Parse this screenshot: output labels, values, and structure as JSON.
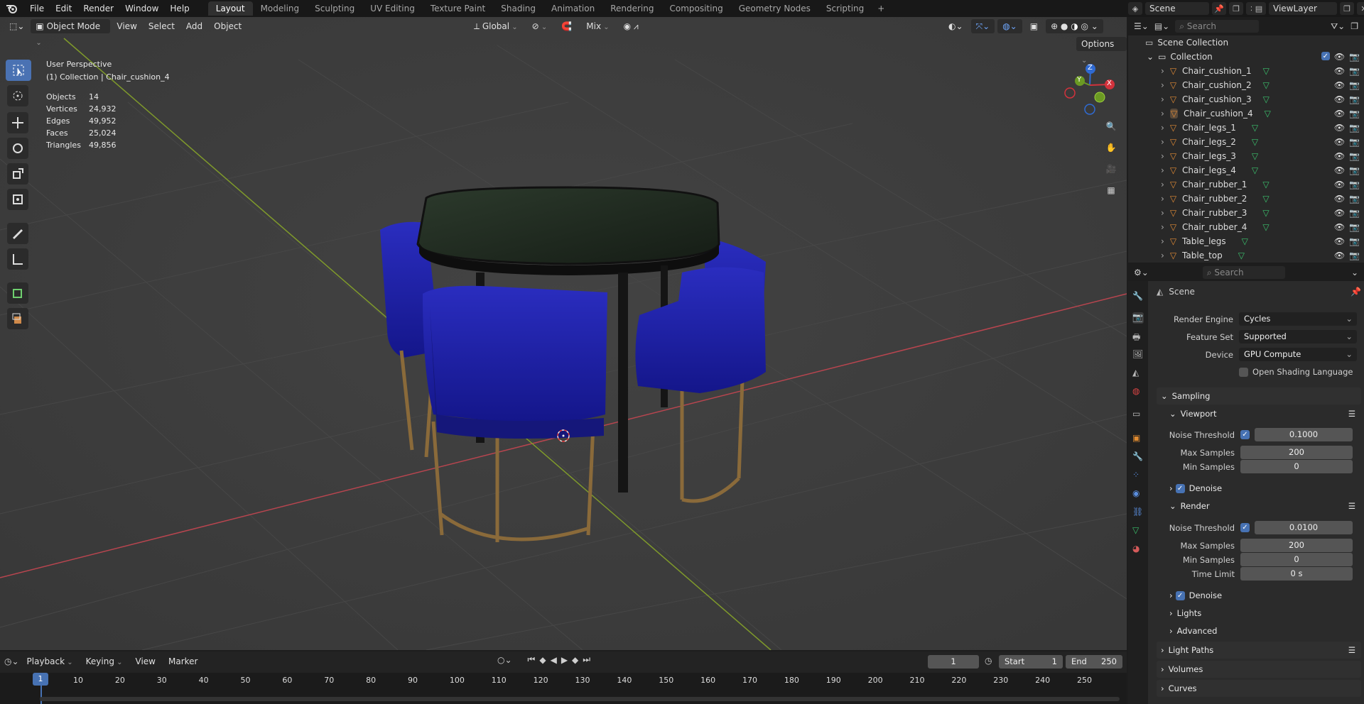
{
  "topbar": {
    "menus": [
      "File",
      "Edit",
      "Render",
      "Window",
      "Help"
    ],
    "workspaces": [
      "Layout",
      "Modeling",
      "Sculpting",
      "UV Editing",
      "Texture Paint",
      "Shading",
      "Animation",
      "Rendering",
      "Compositing",
      "Geometry Nodes",
      "Scripting"
    ],
    "active_workspace": "Layout",
    "add_tab": "+",
    "scene": "Scene",
    "view_layer": "ViewLayer"
  },
  "viewport": {
    "mode": "Object Mode",
    "menus": [
      "View",
      "Select",
      "Add",
      "Object"
    ],
    "orientation": "Global",
    "snap_mode": "Mix",
    "options": "Options",
    "perspective": "User Perspective",
    "context": "(1) Collection | Chair_cushion_4",
    "stats": [
      {
        "label": "Objects",
        "value": "14"
      },
      {
        "label": "Vertices",
        "value": "24,932"
      },
      {
        "label": "Edges",
        "value": "49,952"
      },
      {
        "label": "Faces",
        "value": "25,024"
      },
      {
        "label": "Triangles",
        "value": "49,856"
      }
    ],
    "gizmo": {
      "x": "X",
      "y": "Y",
      "z": "Z"
    }
  },
  "outliner": {
    "search_placeholder": "Search",
    "root": "Scene Collection",
    "collection": "Collection",
    "items": [
      "Chair_cushion_1",
      "Chair_cushion_2",
      "Chair_cushion_3",
      "Chair_cushion_4",
      "Chair_legs_1",
      "Chair_legs_2",
      "Chair_legs_3",
      "Chair_legs_4",
      "Chair_rubber_1",
      "Chair_rubber_2",
      "Chair_rubber_3",
      "Chair_rubber_4",
      "Table_legs",
      "Table_top"
    ],
    "selected": "Chair_cushion_4"
  },
  "properties": {
    "search_placeholder": "Search",
    "context_title": "Scene",
    "render_engine_label": "Render Engine",
    "render_engine": "Cycles",
    "feature_set_label": "Feature Set",
    "feature_set": "Supported",
    "device_label": "Device",
    "device": "GPU Compute",
    "osl_label": "Open Shading Language",
    "sampling": "Sampling",
    "viewport": "Viewport",
    "noise_threshold_label": "Noise Threshold",
    "viewport_noise_threshold": "0.1000",
    "max_samples_label": "Max Samples",
    "viewport_max_samples": "200",
    "min_samples_label": "Min Samples",
    "viewport_min_samples": "0",
    "denoise": "Denoise",
    "render": "Render",
    "render_noise_threshold": "0.0100",
    "render_max_samples": "200",
    "render_min_samples": "0",
    "time_limit_label": "Time Limit",
    "time_limit": "0 s",
    "lights": "Lights",
    "advanced": "Advanced",
    "light_paths": "Light Paths",
    "volumes": "Volumes",
    "curves": "Curves"
  },
  "timeline": {
    "menus": [
      "Playback",
      "Keying",
      "View",
      "Marker"
    ],
    "current_frame": "1",
    "start_label": "Start",
    "start": "1",
    "end_label": "End",
    "end": "250",
    "frame_ticks": [
      "1",
      "10",
      "20",
      "30",
      "40",
      "50",
      "60",
      "70",
      "80",
      "90",
      "100",
      "110",
      "120",
      "130",
      "140",
      "150",
      "160",
      "170",
      "180",
      "190",
      "200",
      "210",
      "220",
      "230",
      "240",
      "250"
    ]
  }
}
